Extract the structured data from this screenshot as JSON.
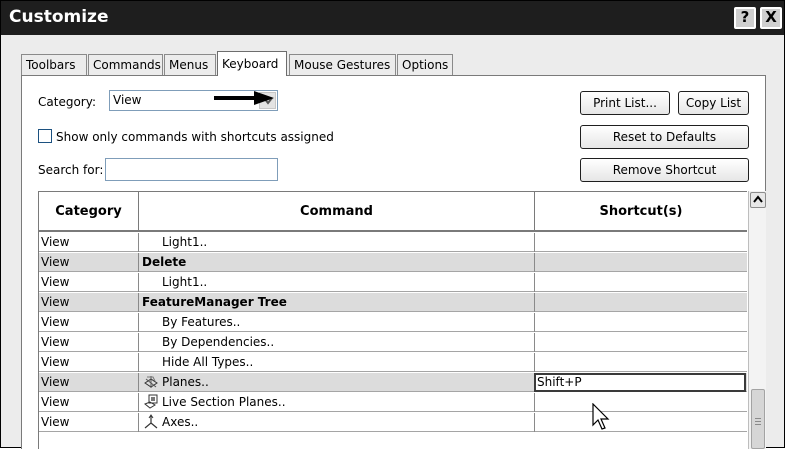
{
  "window": {
    "title": "Customize",
    "help_button": "?",
    "close_button": "X"
  },
  "tabs": [
    {
      "label": "Toolbars",
      "active": false
    },
    {
      "label": "Commands",
      "active": false
    },
    {
      "label": "Menus",
      "active": false
    },
    {
      "label": "Keyboard",
      "active": true
    },
    {
      "label": "Mouse Gestures",
      "active": false
    },
    {
      "label": "Options",
      "active": false
    }
  ],
  "category": {
    "label": "Category:",
    "value": "View"
  },
  "filter": {
    "checkbox_label": "Show only commands with shortcuts assigned",
    "checked": false
  },
  "search": {
    "label": "Search for:",
    "value": ""
  },
  "buttons": {
    "print_list": "Print List...",
    "copy_list": "Copy List",
    "reset_defaults": "Reset to Defaults",
    "remove_shortcut": "Remove Shortcut"
  },
  "grid": {
    "headers": {
      "category": "Category",
      "command": "Command",
      "shortcut": "Shortcut(s)"
    },
    "rows": [
      {
        "category": "View",
        "command": "Light1..",
        "shortcut": "",
        "style": "indent",
        "shaded": false,
        "icon": ""
      },
      {
        "category": "View",
        "command": "Delete",
        "shortcut": "",
        "style": "bold",
        "shaded": true,
        "icon": ""
      },
      {
        "category": "View",
        "command": "Light1..",
        "shortcut": "",
        "style": "indent",
        "shaded": false,
        "icon": ""
      },
      {
        "category": "View",
        "command": "FeatureManager Tree",
        "shortcut": "",
        "style": "bold",
        "shaded": true,
        "icon": ""
      },
      {
        "category": "View",
        "command": "By Features..",
        "shortcut": "",
        "style": "indent",
        "shaded": false,
        "icon": ""
      },
      {
        "category": "View",
        "command": "By Dependencies..",
        "shortcut": "",
        "style": "indent",
        "shaded": false,
        "icon": ""
      },
      {
        "category": "View",
        "command": "Hide All Types..",
        "shortcut": "",
        "style": "indent",
        "shaded": false,
        "icon": ""
      },
      {
        "category": "View",
        "command": "Planes..",
        "shortcut": "Shift+P",
        "style": "icon",
        "shaded": true,
        "icon": "planes-icon",
        "selected": true
      },
      {
        "category": "View",
        "command": "Live Section Planes..",
        "shortcut": "",
        "style": "icon",
        "shaded": false,
        "icon": "live-section-planes-icon"
      },
      {
        "category": "View",
        "command": "Axes..",
        "shortcut": "",
        "style": "icon",
        "shaded": false,
        "icon": "axes-icon"
      }
    ]
  },
  "icons": {
    "dropdown": "chevron-down-icon",
    "callout": "arrow-right-icon",
    "scroll_up": "scroll-up-icon",
    "cursor": "mouse-pointer-icon"
  },
  "colors": {
    "titlebar": "#1e1e1e",
    "shaded_row": "#dcdcdc",
    "panel": "#ececec"
  }
}
